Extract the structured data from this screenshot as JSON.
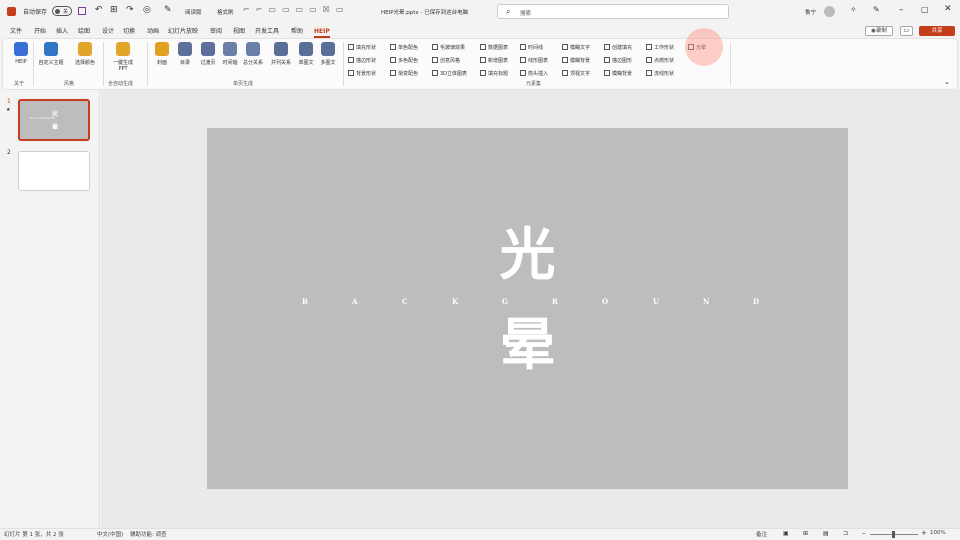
{
  "titlebar": {
    "autosave_label": "自动保存",
    "autosave_state": "关",
    "file_name": "HEIP光晕.pptx - 已保存到这台电脑",
    "search_placeholder": "搜索",
    "user": "鲁宁",
    "mode_label": "阅读版",
    "format_label": "格式刷"
  },
  "tabs": [
    "文件",
    "开始",
    "插入",
    "绘图",
    "设计",
    "切换",
    "动画",
    "幻灯片放映",
    "审阅",
    "视图",
    "开发工具",
    "帮助",
    "HEIP"
  ],
  "active_tab": "HEIP",
  "right_buttons": {
    "record": "录制",
    "share": "共享"
  },
  "ribbon": {
    "groups": [
      {
        "name": "关于",
        "buttons": [
          "HEIP"
        ]
      },
      {
        "name": "风格",
        "buttons": [
          "自定义主题",
          "选择颜色"
        ]
      },
      {
        "name": "全自动生成",
        "buttons": [
          "一键生成PPT"
        ]
      },
      {
        "name": "单页生成",
        "buttons": [
          "封面",
          "目录",
          "过渡页",
          "时间轴",
          "总分关系",
          "并列关系",
          "单图文",
          "多图文"
        ]
      },
      {
        "name": "元素集",
        "buttons": []
      }
    ],
    "checks": [
      [
        "填充形状",
        "单色配色",
        "毛玻璃效果",
        "数据图表",
        "时间线",
        "模糊文字",
        "创建填充",
        "工作形状",
        "光晕"
      ],
      [
        "描边形状",
        "多色配色",
        "创意风格",
        "新增图表",
        "线形图表",
        "模糊背景",
        "描边图形",
        "点燃形状"
      ],
      [
        "背景形状",
        "渐变配色",
        "3D立体图表",
        "填充标题",
        "箭头插入",
        "顶视文字",
        "模糊背景",
        "流线形状"
      ]
    ]
  },
  "slides": [
    {
      "number": "1",
      "marker": "★",
      "thumb_title_1": "光",
      "thumb_title_2": "晕",
      "thumb_sub": "B A C K G R O U N D"
    },
    {
      "number": "2"
    }
  ],
  "slide": {
    "title_line1": "光",
    "title_line2": "晕",
    "subtitle_letters": [
      "B",
      "A",
      "C",
      "K",
      "G",
      "R",
      "O",
      "U",
      "N",
      "D"
    ],
    "background_color": "#bdbdbd"
  },
  "status": {
    "slide_info": "幻灯片 第 1 张，共 2 张",
    "language": "中文(中国)",
    "accessibility": "辅助功能: 调查",
    "notes": "备注",
    "zoom": "100%"
  },
  "colors": {
    "accent": "#c43e1c",
    "highlight": "#ffd6cc"
  }
}
